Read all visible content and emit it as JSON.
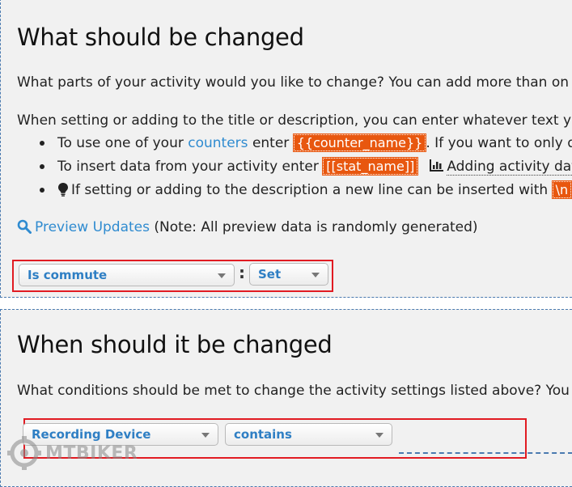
{
  "what_section": {
    "heading": "What should be changed",
    "intro": "What parts of your activity would you like to change? You can add more than on",
    "instructions": "When setting or adding to the title or description, you can enter whatever text yo",
    "bullet1": {
      "prefix": "To use one of your ",
      "link": "counters",
      "middle": " enter ",
      "code": "{{counter_name}}",
      "suffix": ". If you want to only disp"
    },
    "bullet2": {
      "prefix": "To insert data from your activity enter ",
      "code": "[[stat_name]]",
      "link": "Adding activity data"
    },
    "bullet3": {
      "text": "If setting or adding to the description a new line can be inserted with ",
      "code": "\\n"
    },
    "preview_link": "Preview Updates",
    "preview_note": "(Note: All preview data is randomly generated)",
    "field_select": "Is commute",
    "action_select": "Set",
    "separator": ":"
  },
  "when_section": {
    "heading": "When should it be changed",
    "intro": "What conditions should be met to change the activity settings listed above? You",
    "condition_select": "Recording Device",
    "operator_select": "contains"
  },
  "watermark": "MTBIKER",
  "colors": {
    "accent": "#2f8bd0",
    "code_bg": "#e8570f",
    "highlight": "#e11b22"
  }
}
